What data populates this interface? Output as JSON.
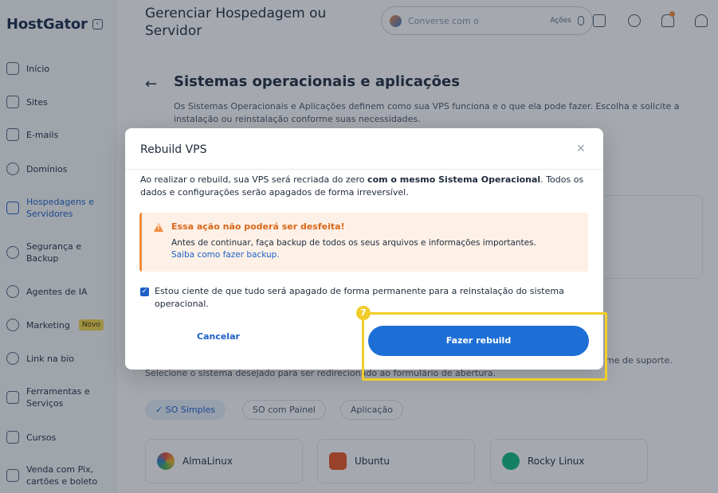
{
  "brand": {
    "name": "HostGator"
  },
  "sidebar": {
    "items": [
      {
        "label": "Início"
      },
      {
        "label": "Sites"
      },
      {
        "label": "E-mails"
      },
      {
        "label": "Domínios"
      },
      {
        "label": "Hospedagens e Servidores"
      },
      {
        "label": "Segurança e Backup"
      },
      {
        "label": "Agentes de IA"
      },
      {
        "label": "Marketing",
        "badge": "Novo"
      },
      {
        "label": "Link na bio"
      },
      {
        "label": "Ferramentas e Serviços"
      },
      {
        "label": "Cursos"
      },
      {
        "label": "Venda com Pix, cartões e boleto"
      }
    ]
  },
  "header": {
    "title": "Gerenciar Hospedagem ou Servidor",
    "chat_placeholder": "Converse com o",
    "actions_label": "Ações"
  },
  "page": {
    "title": "Sistemas operacionais e aplicações",
    "description": "Os Sistemas Operacionais e Aplicações definem como sua VPS funciona e o que ela pode fazer. Escolha e solicite a instalação ou reinstalação conforme suas necessidades.",
    "support_text": "me de suporte.",
    "select_text": "Selecione o sistema desejado para ser redirecionado ao formulário de abertura.",
    "chips": [
      "SO Simples",
      "SO com Painel",
      "Aplicação"
    ],
    "os_cards": [
      "AlmaLinux",
      "Ubuntu",
      "Rocky Linux"
    ]
  },
  "modal": {
    "title": "Rebuild VPS",
    "body_pre": "Ao realizar o rebuild, sua VPS será recriada do zero ",
    "body_bold": "com o mesmo Sistema Operacional",
    "body_post": ". Todos os dados e configurações serão apagados de forma irreversível.",
    "warning": {
      "title": "Essa ação não poderá ser desfeita!",
      "text": "Antes de continuar, faça backup de todos os seus arquivos e informações importantes.",
      "link": "Saiba como fazer backup."
    },
    "checkbox_label": "Estou ciente de que tudo será apagado de forma permanente para a reinstalação do sistema operacional.",
    "checkbox_checked": true,
    "cancel_label": "Cancelar",
    "confirm_label": "Fazer rebuild"
  },
  "tutorial": {
    "step": "7"
  },
  "colors": {
    "accent": "#1d6fd6",
    "warning": "#f28b3b",
    "highlight": "#f1cd2b"
  }
}
